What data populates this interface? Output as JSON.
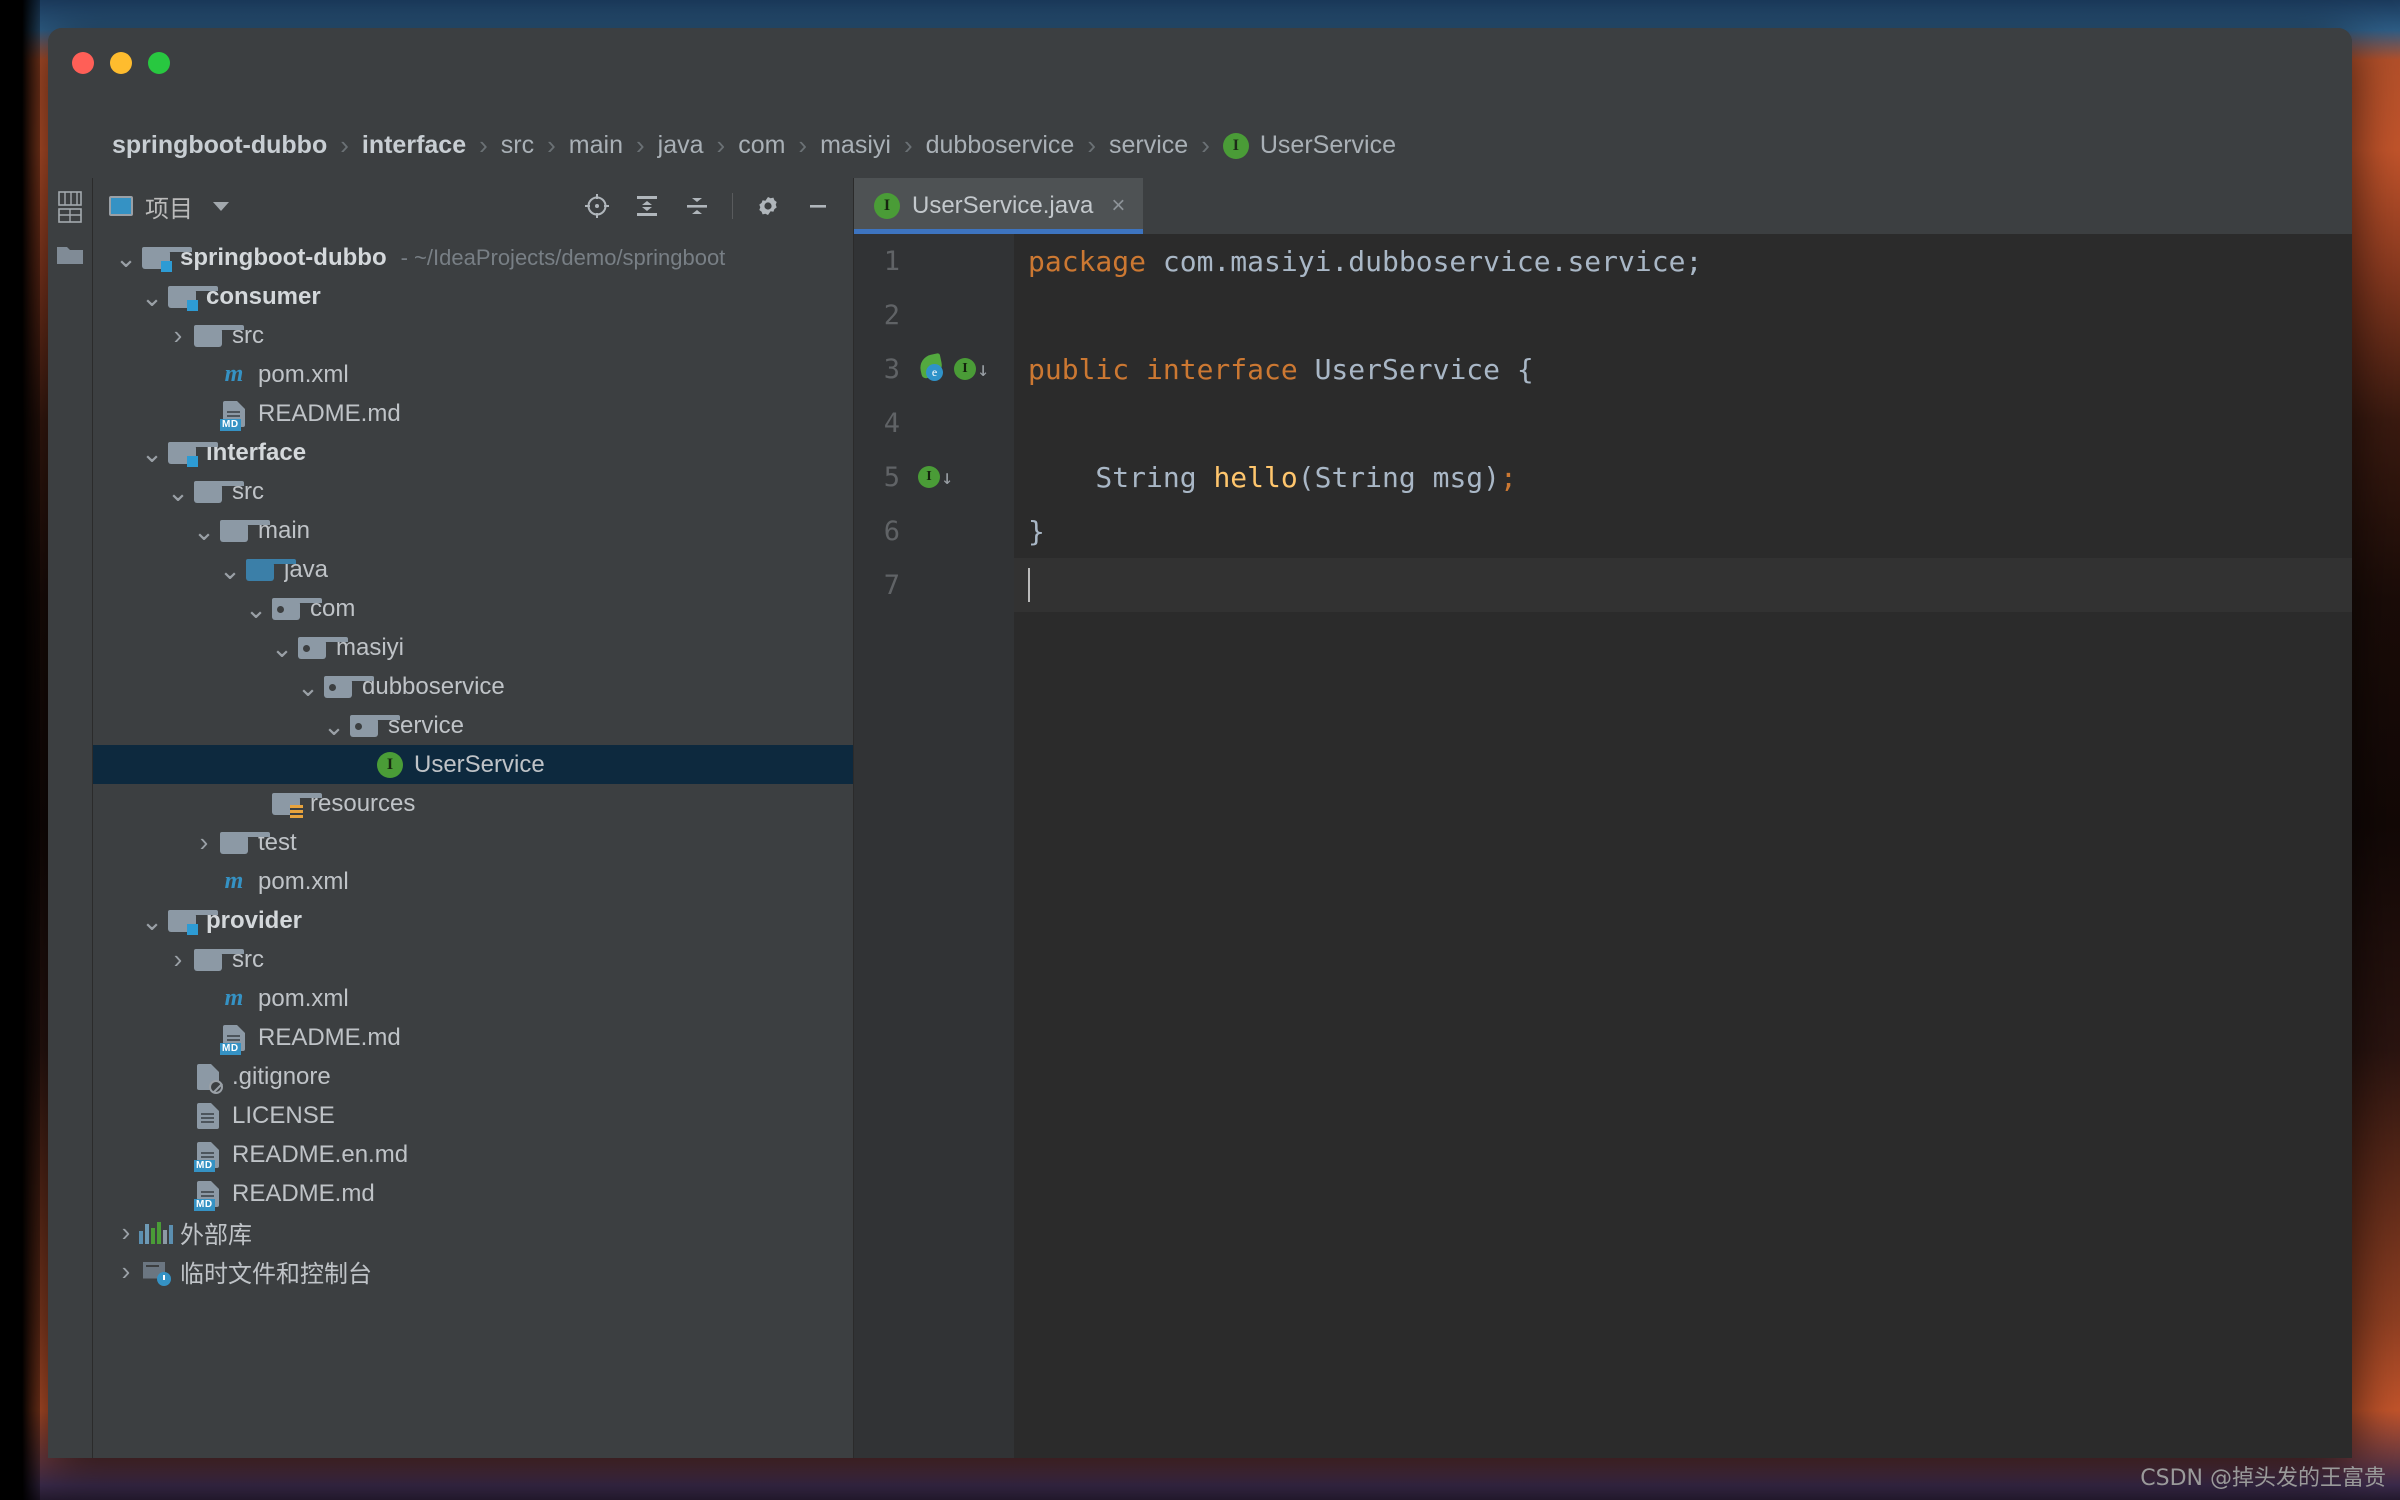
{
  "window": {
    "controls": {
      "close": "close",
      "minimize": "minimize",
      "maximize": "maximize"
    }
  },
  "breadcrumb": {
    "separator": "›",
    "items": [
      {
        "label": "springboot-dubbo",
        "bold": true
      },
      {
        "label": "interface",
        "bold": true
      },
      {
        "label": "src",
        "bold": false
      },
      {
        "label": "main",
        "bold": false
      },
      {
        "label": "java",
        "bold": false
      },
      {
        "label": "com",
        "bold": false
      },
      {
        "label": "masiyi",
        "bold": false
      },
      {
        "label": "dubboservice",
        "bold": false
      },
      {
        "label": "service",
        "bold": false
      },
      {
        "label": "UserService",
        "bold": false,
        "icon": "interface-icon",
        "icon_letter": "I"
      }
    ]
  },
  "tool_stripe": {
    "items": [
      {
        "name": "project-tool-button",
        "label": "项目"
      },
      {
        "name": "structure-tool-button",
        "label": ""
      }
    ]
  },
  "project_panel": {
    "title": "项目",
    "dropdown_caret": "▾",
    "actions": [
      {
        "name": "select-opened-file-button",
        "icon": "target-icon"
      },
      {
        "name": "expand-all-button",
        "icon": "expand-all-icon"
      },
      {
        "name": "collapse-all-button",
        "icon": "collapse-all-icon"
      },
      {
        "name": "settings-button",
        "icon": "gear-icon"
      },
      {
        "name": "hide-panel-button",
        "icon": "minimize-icon"
      }
    ],
    "tree": [
      {
        "indent": 0,
        "arrow": "down",
        "icon": "module-folder",
        "label": "springboot-dubbo",
        "bold": true,
        "sub": "- ~/IdeaProjects/demo/springboot"
      },
      {
        "indent": 1,
        "arrow": "down",
        "icon": "module-folder",
        "label": "consumer",
        "bold": true
      },
      {
        "indent": 2,
        "arrow": "right",
        "icon": "folder",
        "label": "src"
      },
      {
        "indent": 3,
        "arrow": "none",
        "icon": "maven",
        "label": "pom.xml"
      },
      {
        "indent": 3,
        "arrow": "none",
        "icon": "markdown",
        "label": "README.md"
      },
      {
        "indent": 1,
        "arrow": "down",
        "icon": "module-folder",
        "label": "interface",
        "bold": true
      },
      {
        "indent": 2,
        "arrow": "down",
        "icon": "folder",
        "label": "src"
      },
      {
        "indent": 3,
        "arrow": "down",
        "icon": "folder",
        "label": "main"
      },
      {
        "indent": 4,
        "arrow": "down",
        "icon": "source-folder",
        "label": "java"
      },
      {
        "indent": 5,
        "arrow": "down",
        "icon": "package",
        "label": "com"
      },
      {
        "indent": 6,
        "arrow": "down",
        "icon": "package",
        "label": "masiyi"
      },
      {
        "indent": 7,
        "arrow": "down",
        "icon": "package",
        "label": "dubboservice"
      },
      {
        "indent": 8,
        "arrow": "down",
        "icon": "package",
        "label": "service"
      },
      {
        "indent": 9,
        "arrow": "none",
        "icon": "interface",
        "label": "UserService",
        "selected": true
      },
      {
        "indent": 5,
        "arrow": "none",
        "icon": "resource-folder",
        "label": "resources"
      },
      {
        "indent": 3,
        "arrow": "right",
        "icon": "folder",
        "label": "test"
      },
      {
        "indent": 3,
        "arrow": "none",
        "icon": "maven",
        "label": "pom.xml"
      },
      {
        "indent": 1,
        "arrow": "down",
        "icon": "module-folder",
        "label": "provider",
        "bold": true
      },
      {
        "indent": 2,
        "arrow": "right",
        "icon": "folder",
        "label": "src"
      },
      {
        "indent": 3,
        "arrow": "none",
        "icon": "maven",
        "label": "pom.xml"
      },
      {
        "indent": 3,
        "arrow": "none",
        "icon": "markdown",
        "label": "README.md"
      },
      {
        "indent": 2,
        "arrow": "none",
        "icon": "gitignore",
        "label": ".gitignore"
      },
      {
        "indent": 2,
        "arrow": "none",
        "icon": "text-file",
        "label": "LICENSE"
      },
      {
        "indent": 2,
        "arrow": "none",
        "icon": "markdown",
        "label": "README.en.md"
      },
      {
        "indent": 2,
        "arrow": "none",
        "icon": "markdown",
        "label": "README.md"
      },
      {
        "indent": 0,
        "arrow": "right",
        "icon": "library",
        "label": "外部库"
      },
      {
        "indent": 0,
        "arrow": "right",
        "icon": "scratches",
        "label": "临时文件和控制台"
      }
    ]
  },
  "editor": {
    "tabs": [
      {
        "label": "UserService.java",
        "icon": "interface-icon",
        "icon_letter": "I",
        "close": "×",
        "active": true
      }
    ],
    "lines": [
      {
        "number": "1",
        "gutter_icons": [],
        "tokens": [
          {
            "t": "package ",
            "c": "kw"
          },
          {
            "t": "com.masiyi.dubboservice.service;",
            "c": "txt"
          }
        ]
      },
      {
        "number": "2",
        "gutter_icons": [],
        "tokens": []
      },
      {
        "number": "3",
        "gutter_icons": [
          "dubbo-icon",
          "implemented-icon"
        ],
        "tokens": [
          {
            "t": "public interface ",
            "c": "kw"
          },
          {
            "t": "UserService {",
            "c": "txt"
          }
        ]
      },
      {
        "number": "4",
        "gutter_icons": [],
        "tokens": []
      },
      {
        "number": "5",
        "gutter_icons": [
          "implemented-icon"
        ],
        "tokens": [
          {
            "t": "    String ",
            "c": "txt"
          },
          {
            "t": "hello",
            "c": "fn"
          },
          {
            "t": "(String msg)",
            "c": "txt"
          },
          {
            "t": ";",
            "c": "kw"
          }
        ]
      },
      {
        "number": "6",
        "gutter_icons": [],
        "tokens": [
          {
            "t": "}",
            "c": "txt"
          }
        ]
      },
      {
        "number": "7",
        "gutter_icons": [],
        "tokens": [],
        "current": true,
        "caret": true
      }
    ]
  },
  "watermark": "CSDN @掉头发的王富贵",
  "colors": {
    "accent_blue": "#3d74c0",
    "selection": "#0d293e",
    "keyword_orange": "#cc7832",
    "text_blue_grey": "#a9b7c6",
    "method_yellow": "#ffc66d",
    "interface_green": "#4a9c37",
    "panel_bg": "#3c3f41",
    "editor_bg": "#2b2b2b",
    "gutter_bg": "#313335"
  }
}
